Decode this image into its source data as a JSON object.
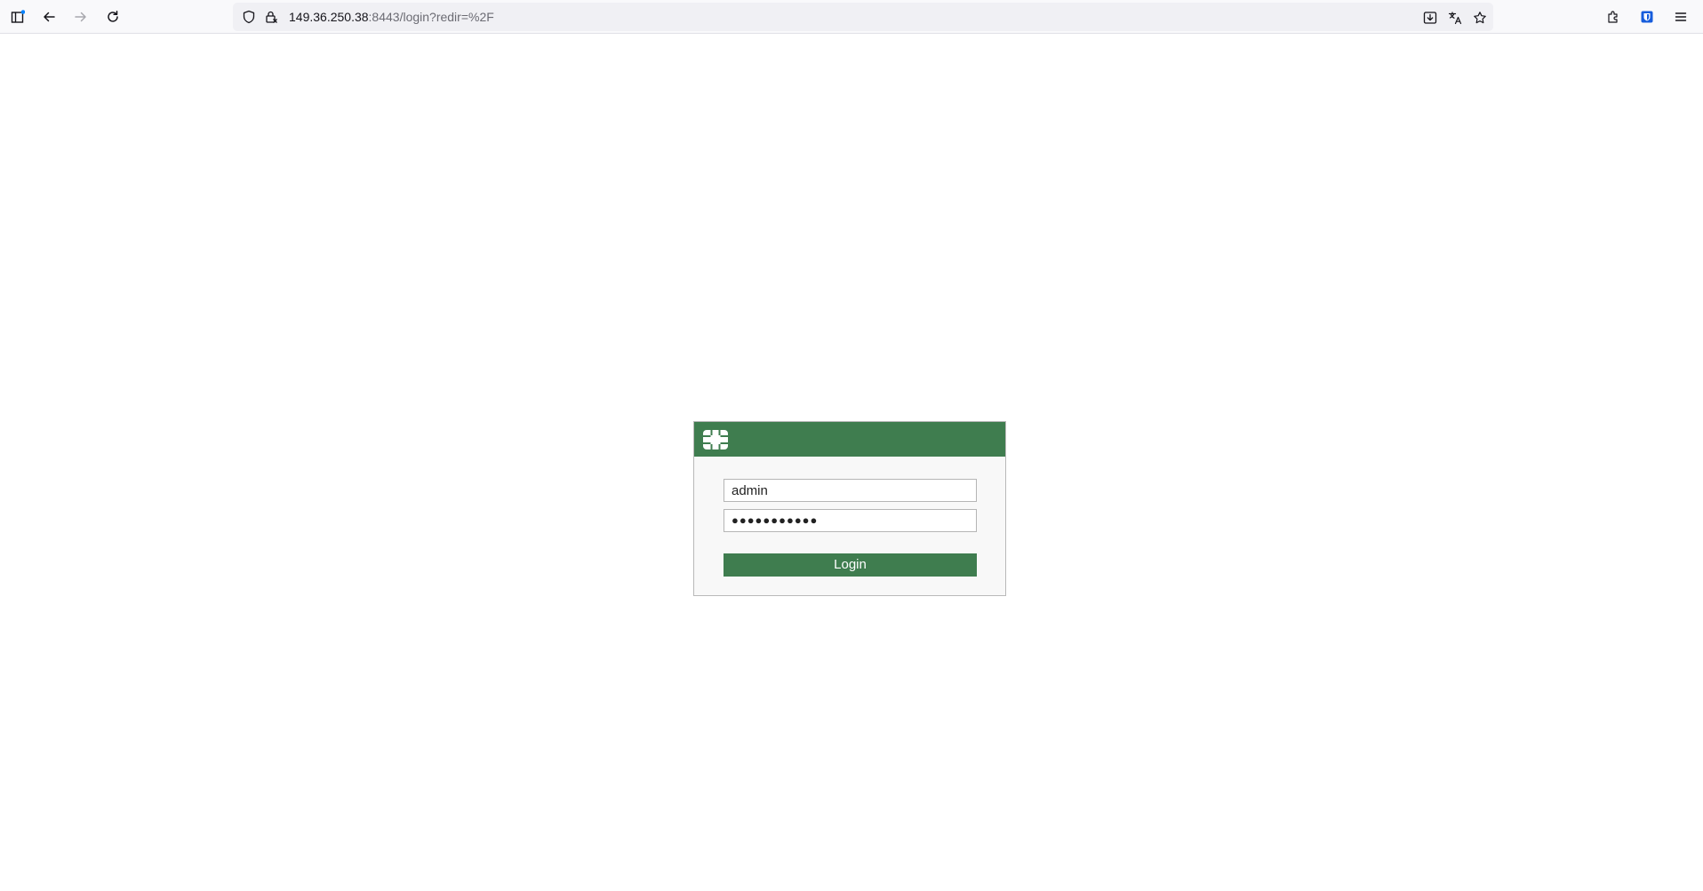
{
  "browser": {
    "url_host": "149.36.250.38",
    "url_rest": ":8443/login?redir=%2F",
    "icons": {
      "sidebar": "sidebar-icon",
      "back": "back-arrow-icon",
      "forward": "forward-arrow-icon",
      "reload": "reload-icon",
      "shield": "shield-icon",
      "lock": "lock-icon",
      "save_page": "save-page-icon",
      "translate": "translate-icon",
      "bookmark": "star-icon",
      "extensions": "extensions-icon",
      "bitwarden": "bitwarden-icon",
      "menu": "hamburger-menu-icon"
    }
  },
  "login": {
    "logo": "fortinet-logo",
    "username_value": "admin",
    "password_value": "●●●●●●●●●●●",
    "button_label": "Login",
    "accent_color": "#3f7d4f"
  }
}
